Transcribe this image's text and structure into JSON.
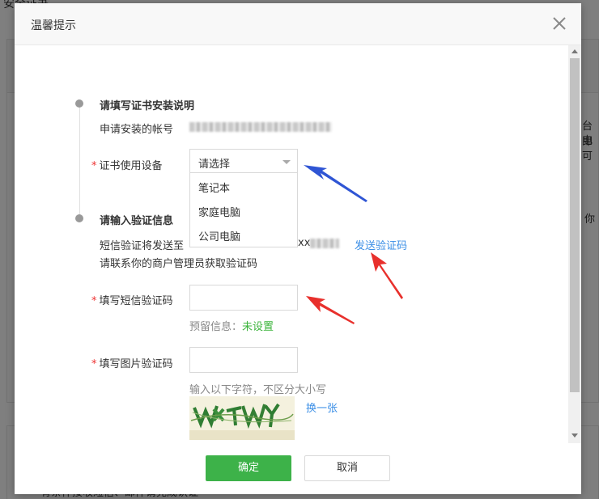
{
  "background": {
    "title": "安全证书",
    "side_text_1": "台电",
    "side_text_2": "即可",
    "side_text_3": "你",
    "bottom_text": "有条件接收短信、邮件请完成认证"
  },
  "dialog": {
    "title": "温馨提示",
    "step1": {
      "title": "请填写证书安装说明",
      "account_label": "申请安装的帐号",
      "device_label": "证书使用设备",
      "device_select_value": "请选择",
      "device_options": [
        "笔记本",
        "家庭电脑",
        "公司电脑"
      ]
    },
    "step2": {
      "title": "请输入验证信息",
      "sms_info": "短信验证将发送至",
      "sms_info_suffix": "xx",
      "contact_admin": "请联系你的商户管理员获取验证码",
      "send_code_link": "发送验证码",
      "sms_code_label": "填写短信验证码",
      "reserved_info_label": "预留信息：",
      "reserved_info_value": "未设置",
      "image_code_label": "填写图片验证码",
      "image_code_hint": "输入以下字符，不区分大小写",
      "refresh_link": "换一张"
    },
    "buttons": {
      "confirm": "确定",
      "cancel": "取消"
    }
  },
  "colors": {
    "primary_green": "#3db249",
    "link_blue": "#3a8ee6",
    "required_red": "#e33333",
    "annotation_blue": "#2f55d4",
    "annotation_red": "#e8302c"
  }
}
